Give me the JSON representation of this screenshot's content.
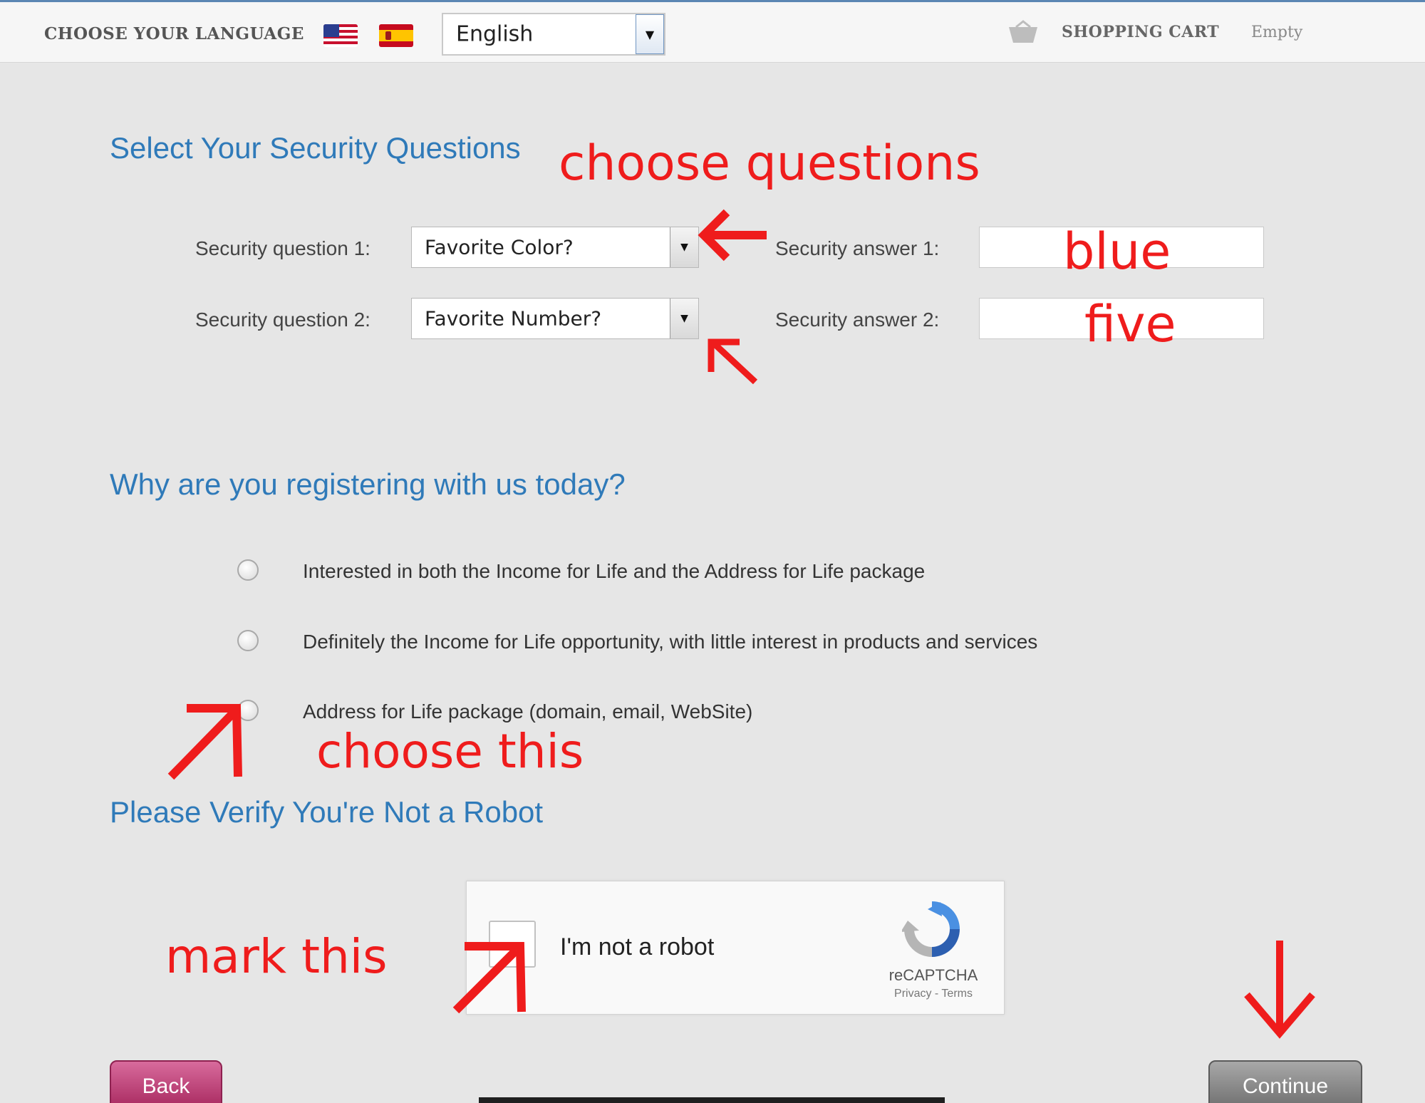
{
  "header": {
    "language_label": "CHOOSE YOUR LANGUAGE",
    "flags": [
      "us-flag-icon",
      "spain-flag-icon"
    ],
    "language_select": {
      "value": "English"
    },
    "cart_label": "SHOPPING CART",
    "cart_status": "Empty"
  },
  "security": {
    "heading": "Select Your Security Questions",
    "question1_label": "Security question 1:",
    "question1_value": "Favorite Color?",
    "question2_label": "Security question 2:",
    "question2_value": "Favorite Number?",
    "answer1_label": "Security answer 1:",
    "answer2_label": "Security answer 2:"
  },
  "registration": {
    "heading": "Why are you registering with us today?",
    "options": [
      "Interested in both the Income for Life and the Address for Life package",
      "Definitely the Income for Life opportunity, with little interest in products and services",
      "Address for Life package (domain, email, WebSite)"
    ]
  },
  "verify": {
    "heading": "Please Verify You're Not a Robot",
    "captcha_text": "I'm not a robot",
    "captcha_brand": "reCAPTCHA",
    "captcha_links": "Privacy - Terms"
  },
  "buttons": {
    "back": "Back",
    "continue": "Continue"
  },
  "annotations": {
    "choose_questions": "choose questions",
    "blue": "blue",
    "five": "five",
    "choose_this": "choose this",
    "mark_this": "mark this",
    "color": "#ef1c1c"
  },
  "colors": {
    "heading": "#2f7ab9",
    "background": "#e6e6e6",
    "back_button": "#c0447a",
    "continue_button": "#8a8a8a"
  }
}
